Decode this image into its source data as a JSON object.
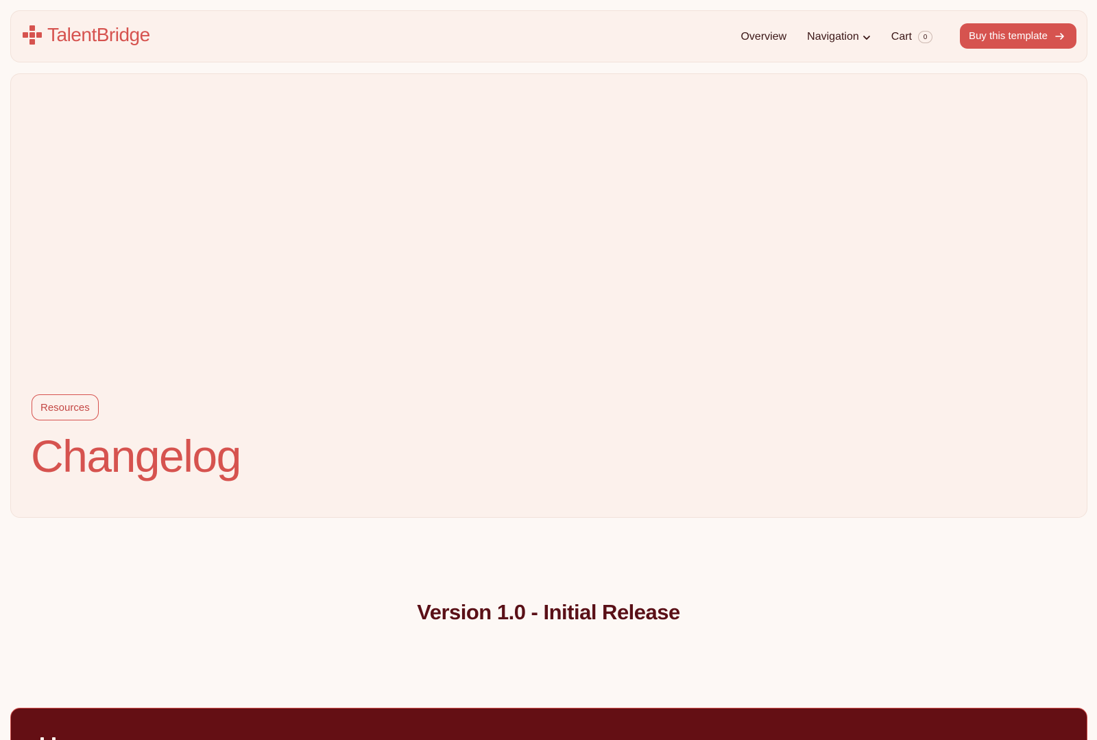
{
  "header": {
    "brand": {
      "name": "TalentBridge",
      "logo_icon": "plus-cross-logo-icon",
      "color": "#d6534f"
    },
    "nav": [
      {
        "label": "Overview"
      },
      {
        "label": "Navigation",
        "icon": "chevron-down-icon"
      },
      {
        "label": "Cart",
        "badge": "0"
      }
    ],
    "cta": {
      "label": "Buy this template",
      "icon": "arrow-right-icon",
      "color": "#d6534f"
    }
  },
  "hero": {
    "tag": "Resources",
    "title": "Changelog"
  },
  "changelog": {
    "version_title": "Version 1.0 - Initial Release"
  },
  "colors": {
    "page_bg": "#fdf8f5",
    "panel_bg": "#fcf1ec",
    "accent": "#d6534f",
    "heading_dark": "#5a1017",
    "dark_section_bg": "#640f14"
  }
}
